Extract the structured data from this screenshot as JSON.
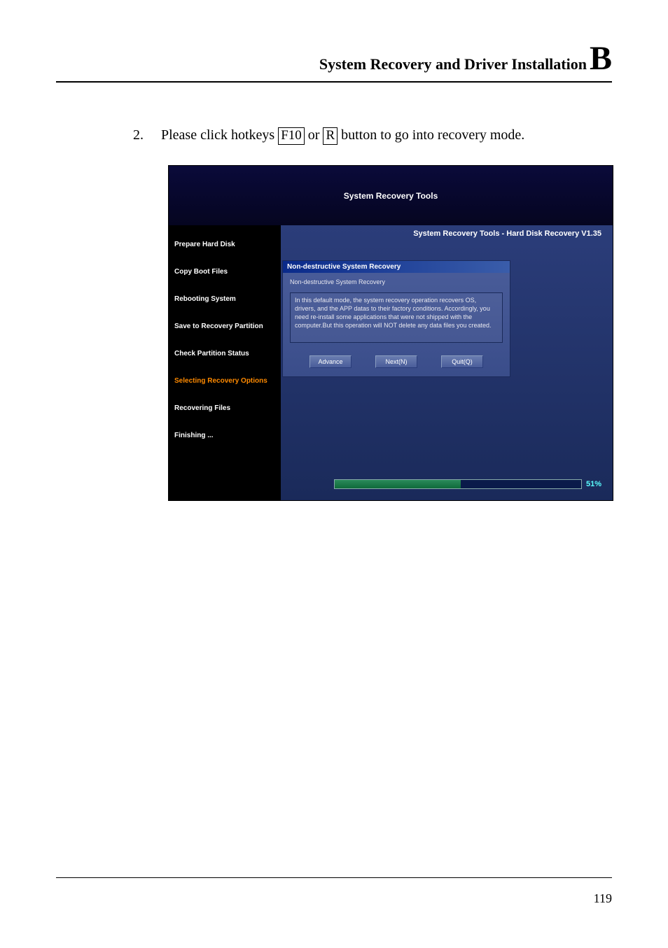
{
  "header": {
    "title": "System Recovery and Driver Installation",
    "letter": "B"
  },
  "step": {
    "number": "2.",
    "prefix": "Please click hotkeys ",
    "key1": "F10",
    "middle": " or ",
    "key2": "R",
    "suffix": " button to go into recovery mode."
  },
  "screenshot": {
    "header_title": "System Recovery Tools",
    "sidebar": [
      "Prepare Hard Disk",
      "Copy Boot Files",
      "Rebooting System",
      "Save to Recovery Partition",
      "Check Partition Status",
      "Selecting Recovery Options",
      "Recovering Files",
      "Finishing ..."
    ],
    "sidebar_active_index": 5,
    "main_title": "System Recovery Tools - Hard Disk Recovery V1.35",
    "dialog": {
      "titlebar": "Non-destructive System Recovery",
      "subtitle": "Non-destructive System Recovery",
      "text": "In this default mode, the system recovery operation recovers OS, drivers, and the APP datas to their factory conditions. Accordingly, you need re-install some applications that were not shipped with the computer.But this operation will NOT delete any data files you created.",
      "buttons": {
        "advance": "Advance",
        "next": "Next(N)",
        "quit": "Quit(Q)"
      }
    },
    "progress": {
      "percent_label": "51%",
      "percent_value": 51
    }
  },
  "page_number": "119"
}
